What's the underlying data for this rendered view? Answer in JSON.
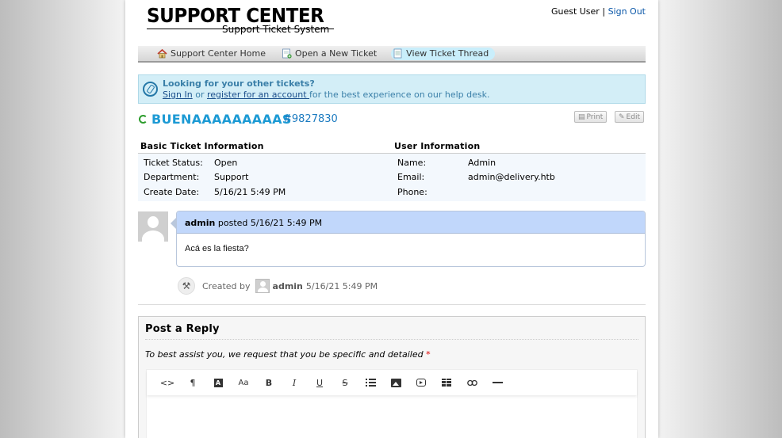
{
  "header": {
    "logo_main": "SUPPORT CENTER",
    "logo_sub": "Support Ticket System",
    "guest_user": "Guest User",
    "separator": "|",
    "sign_out": "Sign Out"
  },
  "nav": {
    "items": [
      {
        "label": "Support Center Home",
        "icon": "home-icon",
        "active": false
      },
      {
        "label": "Open a New Ticket",
        "icon": "new-ticket-icon",
        "active": false
      },
      {
        "label": "View Ticket Thread",
        "icon": "ticket-thread-icon",
        "active": true
      }
    ]
  },
  "notice": {
    "title": "Looking for your other tickets?",
    "sign_in": "Sign In",
    "or": " or ",
    "register": "register for an account ",
    "rest": "for the best experience on our help desk."
  },
  "ticket": {
    "subject": "BUENAAAAAAAAAS",
    "number": "#9827830",
    "print_label": "Print",
    "edit_label": "Edit"
  },
  "basic_info": {
    "title": "Basic Ticket Information",
    "rows": [
      {
        "label": "Ticket Status:",
        "value": "Open"
      },
      {
        "label": "Department:",
        "value": "Support"
      },
      {
        "label": "Create Date:",
        "value": "5/16/21 5:49 PM"
      }
    ]
  },
  "user_info": {
    "title": "User Information",
    "rows": [
      {
        "label": "Name:",
        "value": "Admin"
      },
      {
        "label": "Email:",
        "value": "admin@delivery.htb"
      },
      {
        "label": "Phone:",
        "value": ""
      }
    ]
  },
  "thread": {
    "author": "admin",
    "posted": "posted 5/16/21 5:49 PM",
    "body": "Acá es la fiesta?",
    "event_created_by": "Created by",
    "event_author": "admin",
    "event_date": "5/16/21 5:49 PM"
  },
  "reply": {
    "title": "Post a Reply",
    "instructions": "To best assist you, we request that you be specific and detailed",
    "required_mark": "*",
    "toolbar": [
      {
        "glyph": "<>",
        "name": "code-icon"
      },
      {
        "glyph": "¶",
        "name": "paragraph-icon"
      },
      {
        "glyph": "A",
        "name": "font-color-icon"
      },
      {
        "glyph": "Aa",
        "name": "font-size-icon"
      },
      {
        "glyph": "B",
        "name": "bold-icon"
      },
      {
        "glyph": "I",
        "name": "italic-icon"
      },
      {
        "glyph": "U",
        "name": "underline-icon"
      },
      {
        "glyph": "S",
        "name": "strikethrough-icon"
      },
      {
        "glyph": "",
        "name": "list-icon"
      },
      {
        "glyph": "",
        "name": "image-icon"
      },
      {
        "glyph": "",
        "name": "video-icon"
      },
      {
        "glyph": "",
        "name": "table-icon"
      },
      {
        "glyph": "🔗",
        "name": "link-icon"
      },
      {
        "glyph": "",
        "name": "horizontal-rule-icon"
      }
    ]
  },
  "colors": {
    "accent": "#1c9ad4",
    "link": "#0a57a8",
    "notice_bg": "#d3eef7",
    "entry_header_bg": "#c1d7fb"
  }
}
